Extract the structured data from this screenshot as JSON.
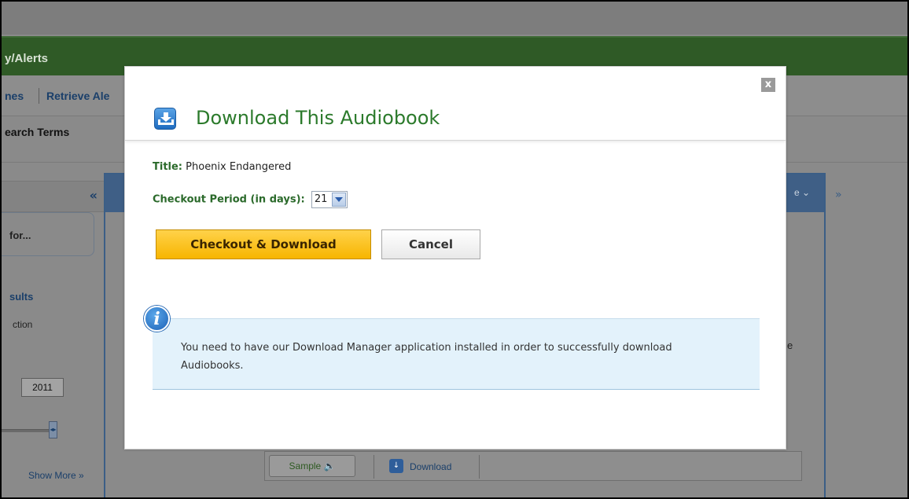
{
  "background": {
    "greenbar_title": "y/Alerts",
    "subnav": {
      "item_a": "nes",
      "item_b": "Retrieve Ale"
    },
    "search_terms_label": "earch Terms",
    "left_collapse_glyph": "«",
    "for_text": "for...",
    "results_label": "sults",
    "ction_text": "ction",
    "year_value": "2011",
    "slider_thumb_glyph": "◂▸",
    "show_more": "Show More »",
    "center_header_right": "e ⌄",
    "right_expand_glyph": "»",
    "e_letter": "e",
    "bottom_bar": {
      "sample_label": "Sample 🔈",
      "download_label": "Download"
    }
  },
  "modal": {
    "title": "Download This Audiobook",
    "close_glyph": "x",
    "title_label": "Title:",
    "title_value": "Phoenix Endangered",
    "period_label": "Checkout Period (in days):",
    "period_value": "21",
    "checkout_button": "Checkout & Download",
    "cancel_button": "Cancel",
    "info_icon_glyph": "i",
    "info_text": "You need to have our Download Manager application installed in order to successfully download Audiobooks."
  },
  "colors": {
    "title_green": "#2b7a2b",
    "label_green": "#2b6a2b",
    "checkout_yellow": "#f7b500",
    "info_bg": "#e3f2fb",
    "overlay_green": "#2f5a26",
    "panel_blue": "#3f5f86"
  },
  "icons": {
    "title_icon": "download-arrow-icon",
    "close_icon": "close-icon",
    "info_icon": "info-icon",
    "dropdown_icon": "chevron-down-icon"
  }
}
